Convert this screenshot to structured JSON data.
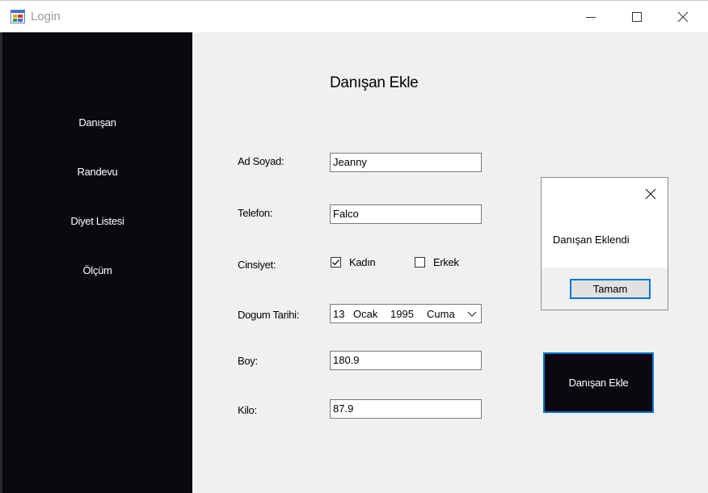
{
  "window": {
    "title": "Login"
  },
  "sidebar": {
    "items": [
      {
        "label": "Danışan"
      },
      {
        "label": "Randevu"
      },
      {
        "label": "Diyet Listesi"
      },
      {
        "label": "Ölçüm"
      }
    ]
  },
  "form": {
    "title": "Danışan Ekle",
    "name_label": "Ad Soyad:",
    "name_value": "Jeanny",
    "phone_label": "Telefon:",
    "phone_value": "Falco",
    "gender_label": "Cinsiyet:",
    "gender_female": {
      "label": "Kadın",
      "checked": true
    },
    "gender_male": {
      "label": "Erkek",
      "checked": false
    },
    "birthdate_label": "Dogum Tarihi:",
    "birthdate": {
      "day": "13",
      "month": "Ocak",
      "year": "1995",
      "weekday": "Cuma"
    },
    "height_label": "Boy:",
    "height_value": "180.9",
    "weight_label": "Kilo:",
    "weight_value": "87.9",
    "submit_label": "Danışan Ekle"
  },
  "dialog": {
    "message": "Danışan Eklendi",
    "ok_label": "Tamam"
  },
  "colors": {
    "sidebar_bg": "#0b0810",
    "accent": "#0078d7",
    "window_bg": "#f0f0f0"
  }
}
